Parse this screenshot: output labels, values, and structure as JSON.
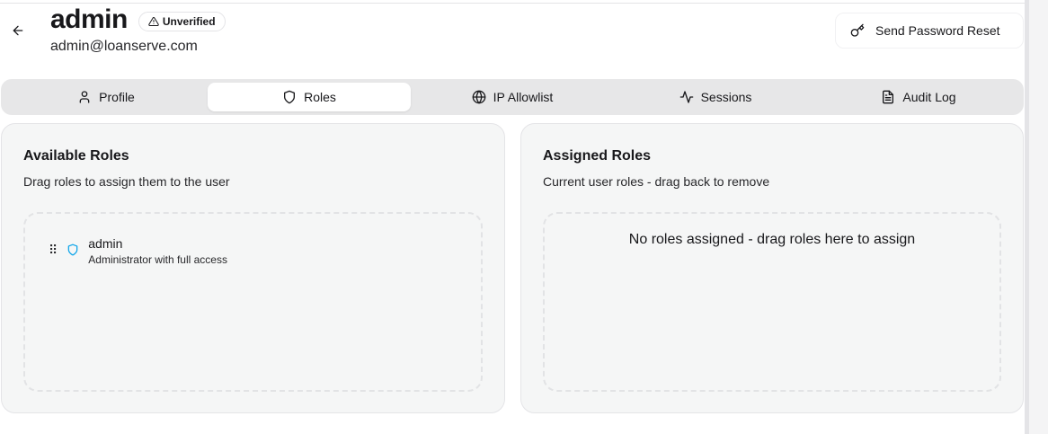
{
  "user": {
    "name": "admin",
    "status_badge": "Unverified",
    "email": "admin@loanserve.com"
  },
  "actions": {
    "reset_label": "Send Password Reset"
  },
  "tabs": [
    {
      "label": "Profile",
      "icon": "user-icon"
    },
    {
      "label": "Roles",
      "icon": "shield-icon"
    },
    {
      "label": "IP Allowlist",
      "icon": "globe-icon"
    },
    {
      "label": "Sessions",
      "icon": "activity-icon"
    },
    {
      "label": "Audit Log",
      "icon": "file-text-icon"
    }
  ],
  "active_tab": "Roles",
  "available": {
    "title": "Available Roles",
    "description": "Drag roles to assign them to the user",
    "roles": [
      {
        "name": "admin",
        "description": "Administrator with full access"
      }
    ]
  },
  "assigned": {
    "title": "Assigned Roles",
    "description": "Current user roles - drag back to remove",
    "empty_message": "No roles assigned - drag roles here to assign"
  },
  "colors": {
    "accent": "#0ea5e9",
    "tab_bar": "#e7e7e8",
    "card_bg": "#f5f6f6"
  }
}
